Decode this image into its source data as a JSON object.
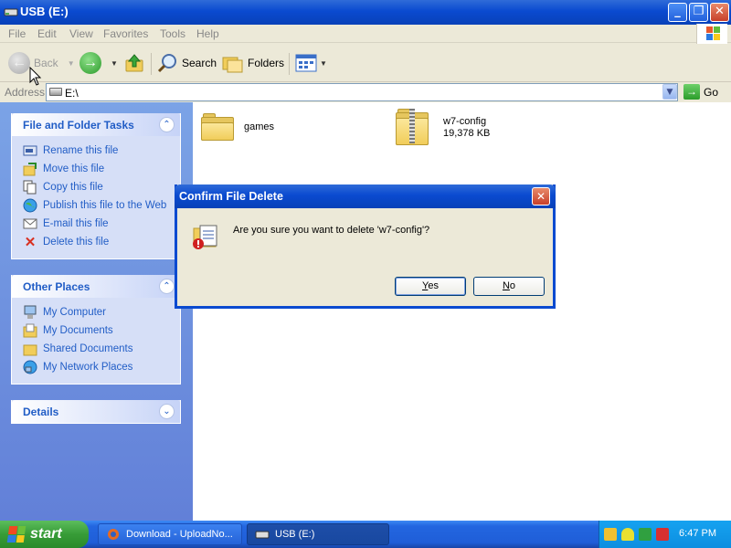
{
  "window": {
    "title": "USB (E:)",
    "min": "_",
    "max": "❐",
    "close": "✕"
  },
  "menu": [
    "File",
    "Edit",
    "View",
    "Favorites",
    "Tools",
    "Help"
  ],
  "toolbar": {
    "back": "Back",
    "search": "Search",
    "folders": "Folders"
  },
  "address": {
    "label": "Address",
    "value": "E:\\",
    "go": "Go"
  },
  "tasks": {
    "file_folder": {
      "title": "File and Folder Tasks",
      "items": [
        "Rename this file",
        "Move this file",
        "Copy this file",
        "Publish this file to the Web",
        "E-mail this file",
        "Delete this file"
      ]
    },
    "other_places": {
      "title": "Other Places",
      "items": [
        "My Computer",
        "My Documents",
        "Shared Documents",
        "My Network Places"
      ]
    },
    "details": {
      "title": "Details"
    }
  },
  "files": [
    {
      "name": "games",
      "type": "folder"
    },
    {
      "name": "w7-config",
      "size": "19,378 KB",
      "type": "zip"
    }
  ],
  "dialog": {
    "title": "Confirm File Delete",
    "message": "Are you sure you want to delete 'w7-config'?",
    "yes_label": "es",
    "yes_hotkey": "Y",
    "no_label": "o",
    "no_hotkey": "N"
  },
  "taskbar": {
    "start": "start",
    "items": [
      "Download - UploadNo...",
      "USB (E:)"
    ],
    "clock": "6:47 PM"
  }
}
